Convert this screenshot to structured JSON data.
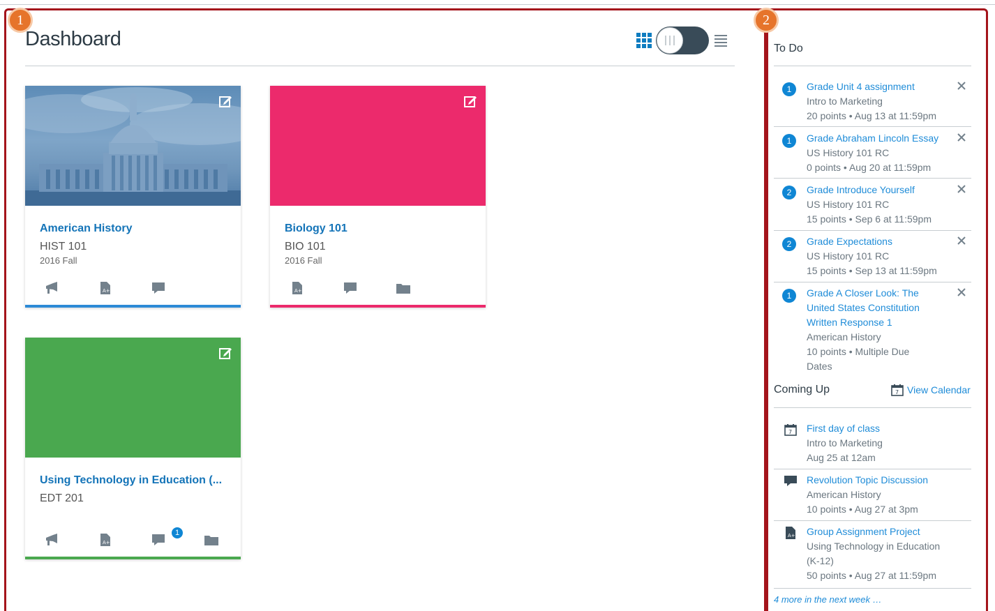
{
  "header": {
    "title": "Dashboard"
  },
  "annotations": [
    "1",
    "2"
  ],
  "colors": {
    "accent": "#0f86d4",
    "annotation": "#a4141b",
    "badge": "#e6742b"
  },
  "cards": [
    {
      "title": "American History",
      "code": "HIST 101",
      "term": "2016 Fall",
      "color": "#2d8ad6",
      "image": "capitol",
      "icons": [
        "announcement-icon",
        "assignment-icon",
        "discussion-icon"
      ]
    },
    {
      "title": "Biology 101",
      "code": "BIO 101",
      "term": "2016 Fall",
      "color": "#ec2a6c",
      "icons": [
        "assignment-icon",
        "discussion-icon",
        "folder-icon"
      ]
    },
    {
      "title": "Using Technology in Education (...",
      "code": "EDT 201",
      "term": "",
      "color": "#4aa84f",
      "icons": [
        "announcement-icon",
        "assignment-icon",
        "discussion-icon",
        "folder-icon"
      ],
      "discussion_badge": "1"
    }
  ],
  "todo": {
    "title": "To Do",
    "items": [
      {
        "count": "1",
        "title": "Grade Unit 4 assignment",
        "course": "Intro to Marketing",
        "meta": "20 points • Aug 13 at 11:59pm"
      },
      {
        "count": "1",
        "title": "Grade Abraham Lincoln Essay",
        "course": "US History 101 RC",
        "meta": "0 points • Aug 20 at 11:59pm"
      },
      {
        "count": "2",
        "title": "Grade Introduce Yourself",
        "course": "US History 101 RC",
        "meta": "15 points • Sep 6 at 11:59pm"
      },
      {
        "count": "2",
        "title": "Grade Expectations",
        "course": "US History 101 RC",
        "meta": "15 points • Sep 13 at 11:59pm"
      },
      {
        "count": "1",
        "title": "Grade A Closer Look: The United States Constitution Written Response 1",
        "course": "American History",
        "meta": "10 points • Multiple Due Dates"
      }
    ]
  },
  "coming_up": {
    "title": "Coming Up",
    "view_calendar": "View Calendar",
    "calendar_day": "7",
    "items": [
      {
        "icon": "calendar-icon",
        "title": "First day of class",
        "course": "Intro to Marketing",
        "meta": "Aug 25 at 12am"
      },
      {
        "icon": "discussion-icon",
        "title": "Revolution Topic Discussion",
        "course": "American History",
        "meta": "10 points • Aug 27 at 3pm"
      },
      {
        "icon": "assignment-icon",
        "title": "Group Assignment Project",
        "course": "Using Technology in Education (K-12)",
        "meta": "50 points • Aug 27 at 11:59pm"
      }
    ],
    "more": "4 more in the next week …"
  }
}
